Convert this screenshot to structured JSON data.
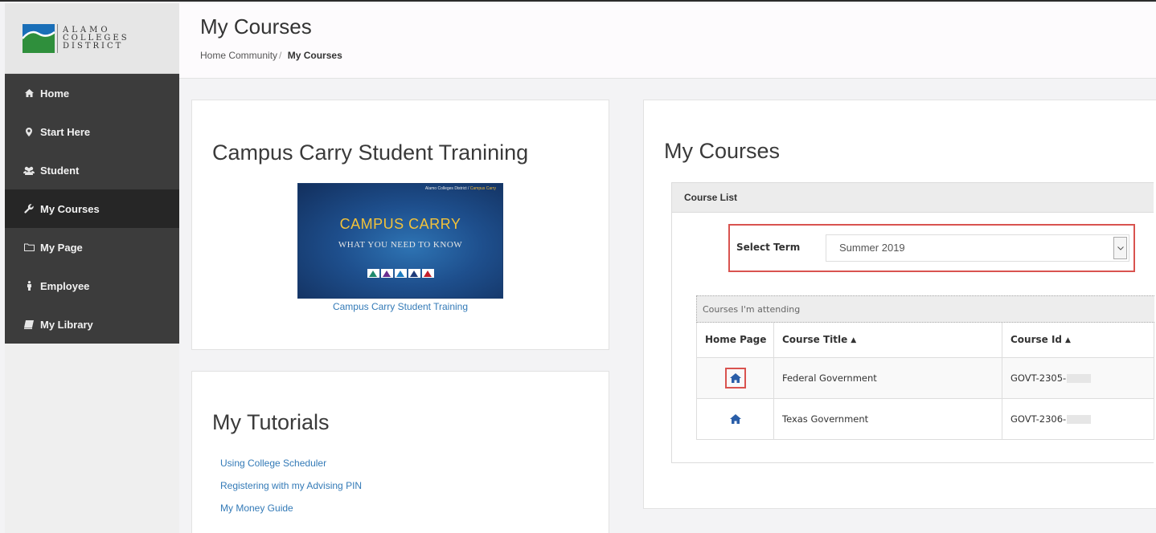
{
  "logo": {
    "line1": "ALAMO",
    "line2": "COLLEGES",
    "line3": "DISTRICT"
  },
  "sidebar": {
    "items": [
      {
        "label": "Home",
        "icon": "home-icon"
      },
      {
        "label": "Start Here",
        "icon": "map-marker-icon"
      },
      {
        "label": "Student",
        "icon": "users-icon"
      },
      {
        "label": "My Courses",
        "icon": "wrench-icon",
        "active": true
      },
      {
        "label": "My Page",
        "icon": "folder-icon"
      },
      {
        "label": "Employee",
        "icon": "person-icon"
      },
      {
        "label": "My Library",
        "icon": "book-icon"
      }
    ]
  },
  "header": {
    "title": "My Courses",
    "breadcrumb": {
      "parent": "Home Community",
      "separator": "/",
      "current": "My Courses"
    }
  },
  "campus_carry": {
    "heading": "Campus Carry Student Tranining",
    "video": {
      "top_label_a": "Alamo Colleges District /",
      "top_label_b": "Campus Carry",
      "title": "CAMPUS CARRY",
      "subtitle": "WHAT YOU NEED TO KNOW"
    },
    "link": "Campus Carry Student Training"
  },
  "tutorials": {
    "heading": "My Tutorials",
    "links": [
      "Using College Scheduler",
      "Registering with my Advising PIN",
      "My Money Guide"
    ]
  },
  "courses": {
    "heading": "My Courses",
    "box_title": "Course List",
    "term_label": "Select Term",
    "term_value": "Summer 2019",
    "table_caption": "Courses I'm attending",
    "columns": [
      "Home Page",
      "Course Title",
      "Course Id"
    ],
    "rows": [
      {
        "title": "Federal Government",
        "id": "GOVT-2305-"
      },
      {
        "title": "Texas Government",
        "id": "GOVT-2306-"
      }
    ]
  },
  "colors": {
    "sidebar": "#3c3c3c",
    "sidebar_active": "#262626",
    "link": "#337ab7",
    "highlight": "#d9534f",
    "home_icon": "#2a5ea8"
  }
}
